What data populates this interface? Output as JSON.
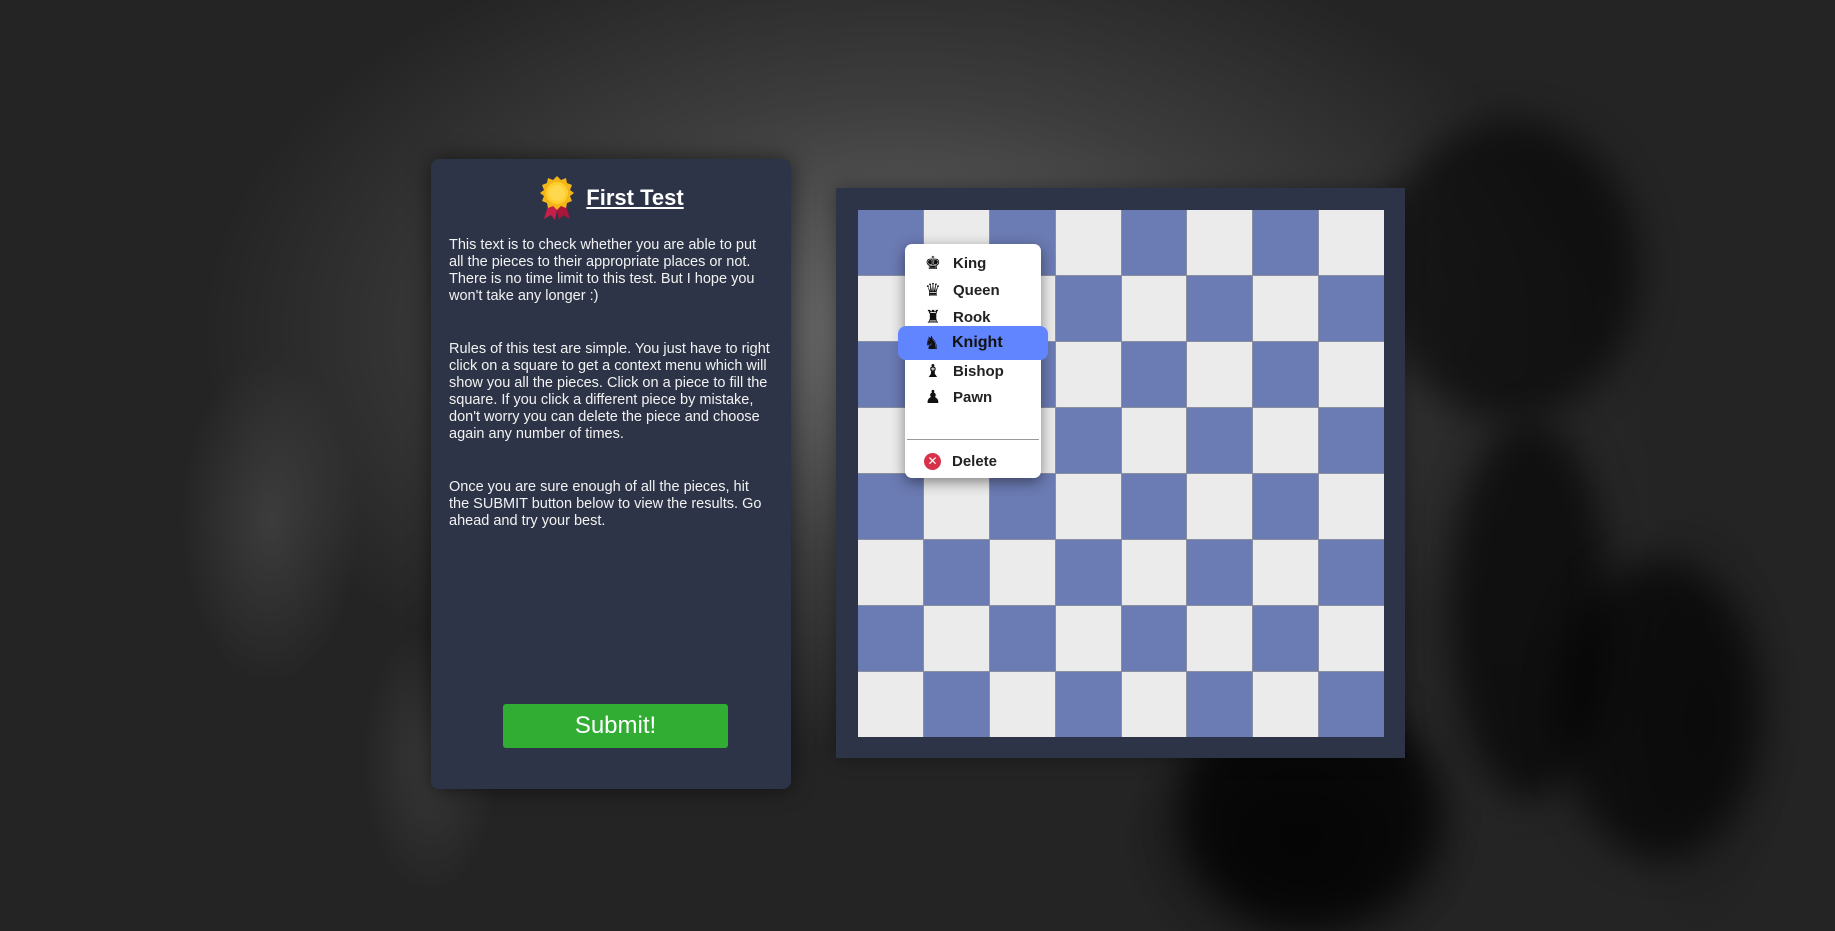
{
  "panel": {
    "title": "First Test",
    "paragraphs": [
      "This text is to check whether you are able to put all the pieces to their appropriate places or not. There is no time limit to this test. But I hope you won't take any longer :)",
      "Rules of this test are simple. You just have to right click on a square to get a context menu which will show you all the pieces. Click on a piece to fill the square. If you click a different piece by mistake, don't worry you can delete the piece and choose again any number of times.",
      "Once you are sure enough of all the pieces, hit the SUBMIT button below to view the results. Go ahead and try your best."
    ],
    "submit_label": "Submit!",
    "icon": "medal-icon"
  },
  "board": {
    "size": 8,
    "light_color": "#ebebeb",
    "dark_color": "#6b7bb3"
  },
  "context_menu": {
    "items": [
      {
        "label": "King",
        "glyph": "♚",
        "icon": "king-icon"
      },
      {
        "label": "Queen",
        "glyph": "♛",
        "icon": "queen-icon"
      },
      {
        "label": "Rook",
        "glyph": "♜",
        "icon": "rook-icon"
      },
      {
        "label": "Knight",
        "glyph": "♞",
        "icon": "knight-icon",
        "active": true
      },
      {
        "label": "Bishop",
        "glyph": "♝",
        "icon": "bishop-icon"
      },
      {
        "label": "Pawn",
        "glyph": "♟",
        "icon": "pawn-icon"
      }
    ],
    "delete_label": "Delete",
    "delete_glyph": "✕",
    "highlight_color": "#6184ff"
  },
  "colors": {
    "panel_bg": "#2d3447",
    "submit_bg": "#31ad34",
    "delete_icon": "#d6334a"
  }
}
